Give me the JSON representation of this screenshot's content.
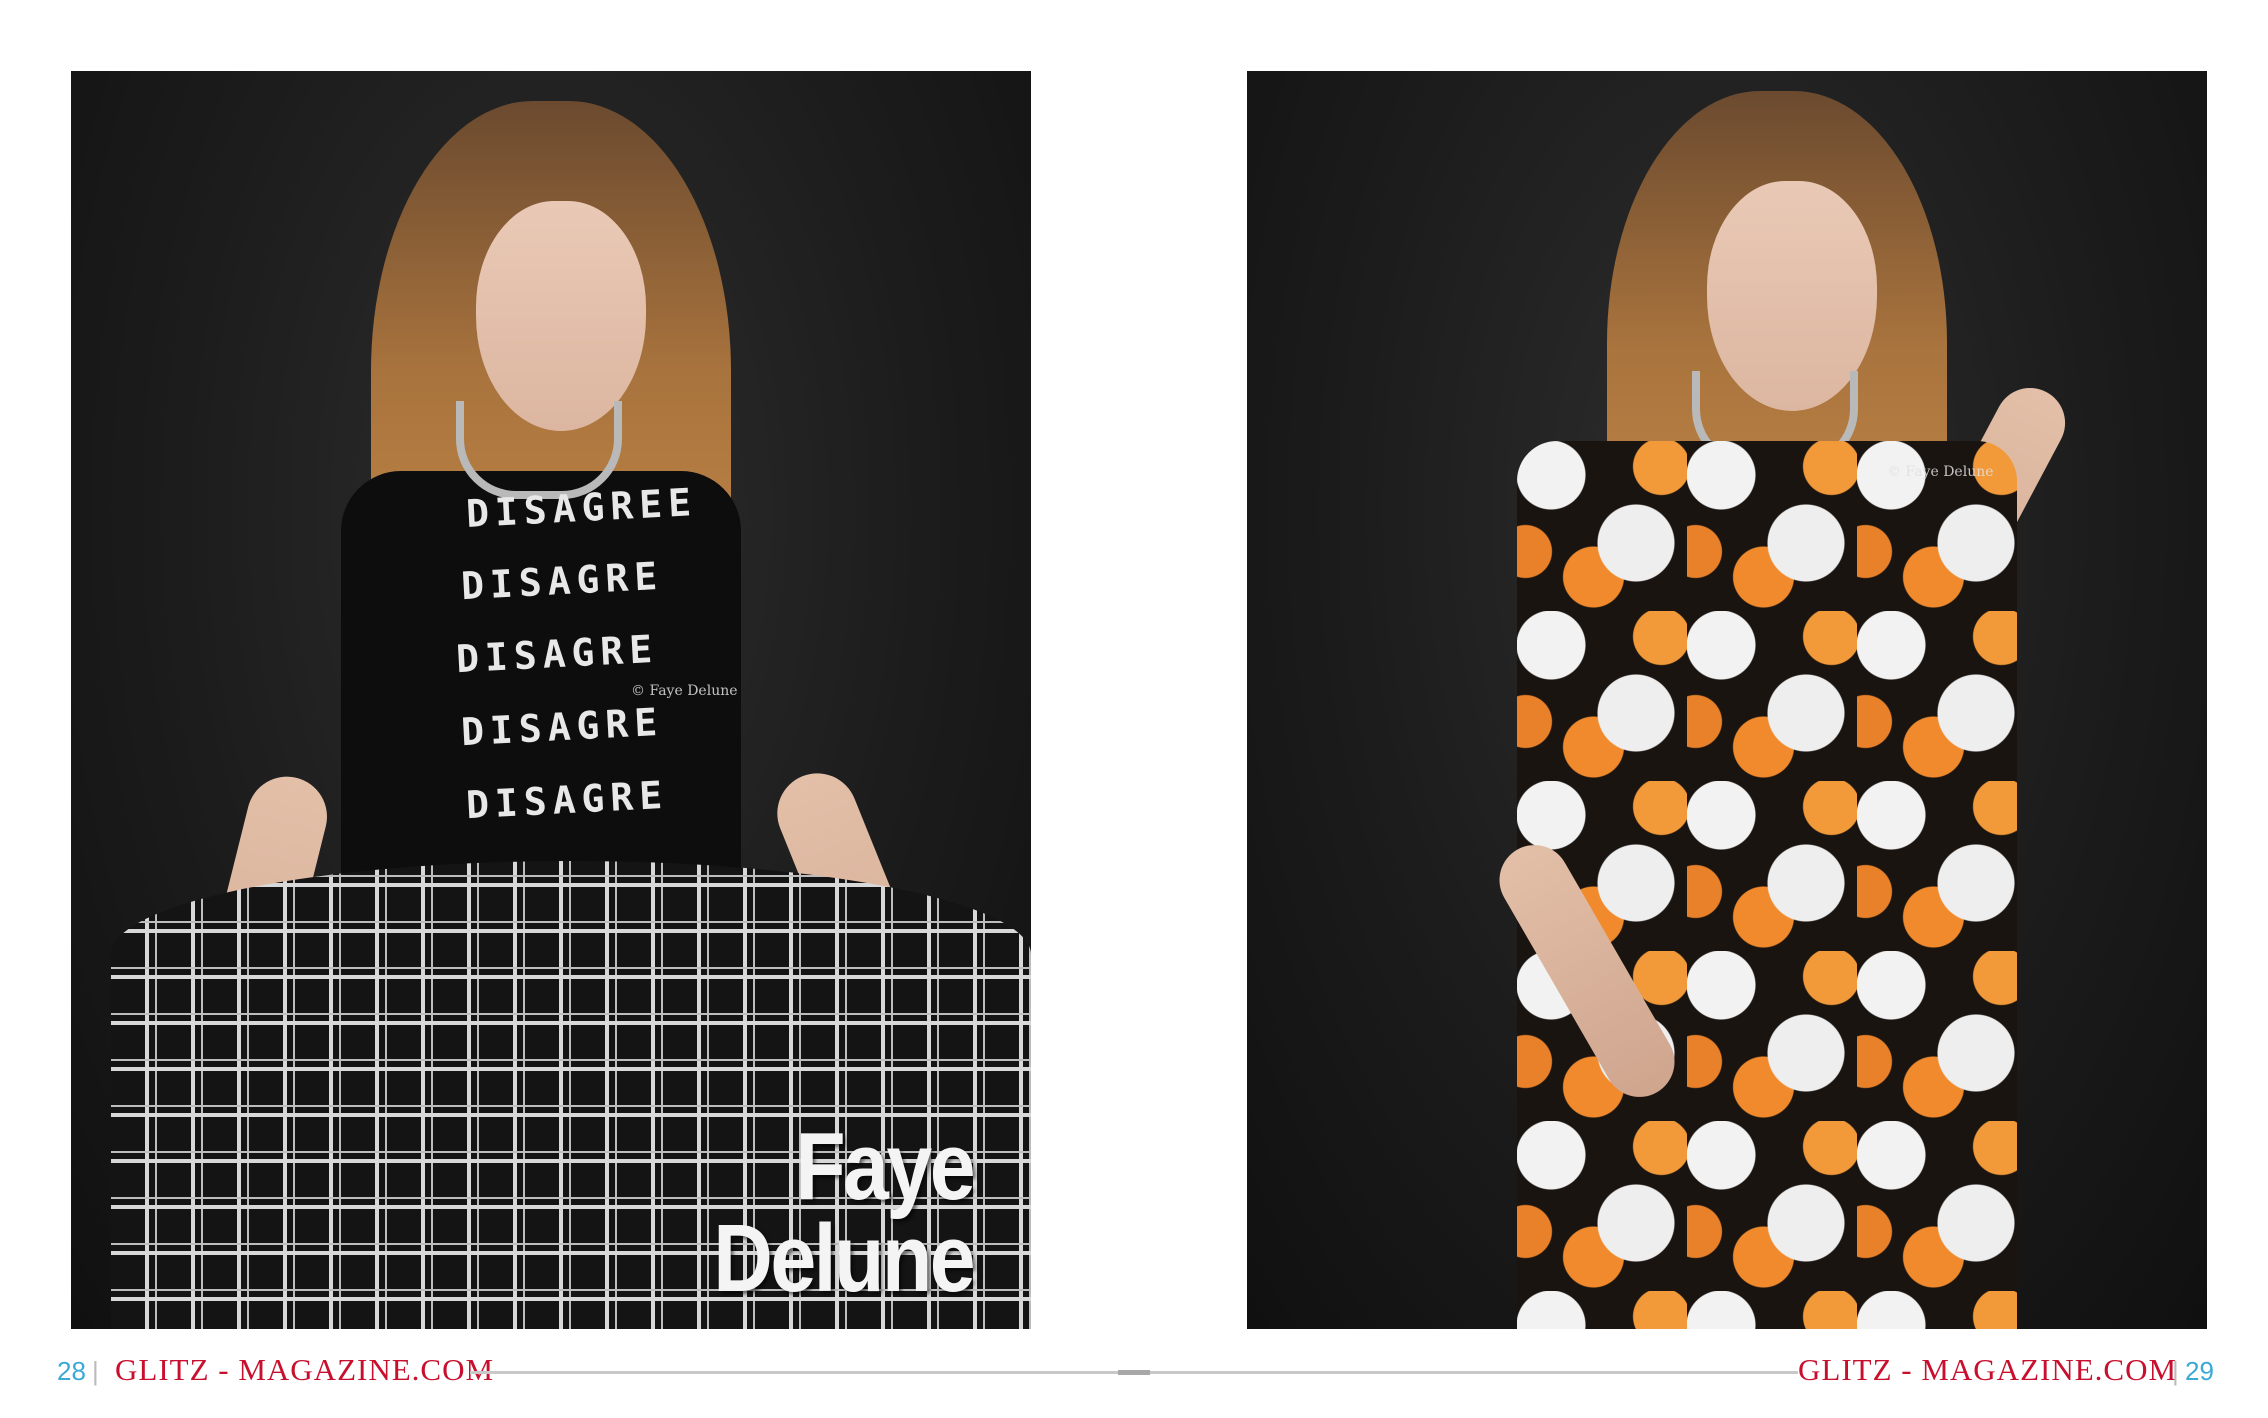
{
  "left_page": {
    "photo_caption_line1": "Faye",
    "photo_caption_line2": "Delune",
    "watermark": "© Faye Delune",
    "shirt_text": [
      "DISAGREE",
      "DISAGRE",
      "DISAGRE",
      "DISAGRE",
      "DISAGRE"
    ],
    "page_number": "28",
    "separator": "|",
    "site": "GLITZ - MAGAZINE.COM"
  },
  "right_page": {
    "watermark": "© Faye Delune",
    "page_number": "29",
    "separator": "|",
    "site": "GLITZ - MAGAZINE.COM"
  },
  "colors": {
    "brand_red": "#c8102e",
    "page_number_blue": "#3aa9d8",
    "rule_gray": "#c8c8c8"
  }
}
